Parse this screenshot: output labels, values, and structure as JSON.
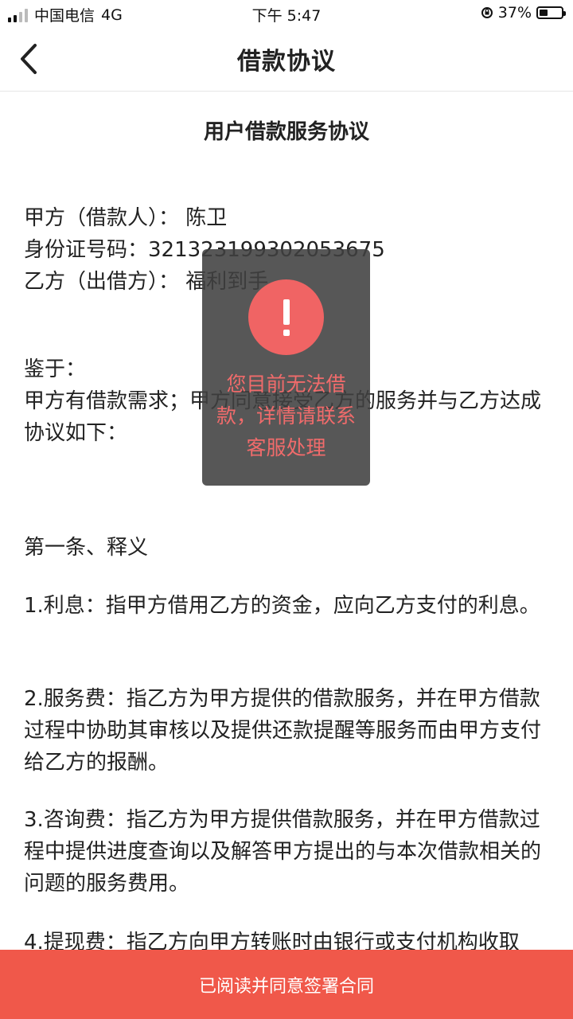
{
  "status_bar": {
    "carrier": "中国电信",
    "network": "4G",
    "time": "下午 5:47",
    "battery_percent": "37%",
    "battery_level": 0.37
  },
  "nav": {
    "back_icon": "chevron-left-icon",
    "title": "借款协议"
  },
  "document": {
    "title": "用户借款服务协议",
    "party_a": "甲方（借款人）： 陈卫",
    "id_number": "身份证号码：321323199302053675",
    "party_b": "乙方（出借方）： 福利到手",
    "whereas_label": "鉴于：",
    "whereas_text": "甲方有借款需求；甲方同意接受乙方的服务并与乙方达成协议如下：",
    "article_1_title": "第一条、释义",
    "clause_1": "1.利息：指甲方借用乙方的资金，应向乙方支付的利息。",
    "clause_2": "2.服务费：指乙方为甲方提供的借款服务，并在甲方借款过程中协助其审核以及提供还款提醒等服务而由甲方支付给乙方的报酬。",
    "clause_3": "3.咨询费：指乙方为甲方提供借款服务，并在甲方借款过程中提供进度查询以及解答甲方提出的与本次借款相关的问题的服务费用。",
    "clause_4": "4.提现费：指乙方向甲方转账时由银行或支付机构收取"
  },
  "toast": {
    "icon": "exclamation-icon",
    "message": "您目前无法借款，详情请联系客服处理",
    "accent_color": "#f06464"
  },
  "footer": {
    "sign_button": "已阅读并同意签署合同",
    "button_color": "#f0584a"
  }
}
